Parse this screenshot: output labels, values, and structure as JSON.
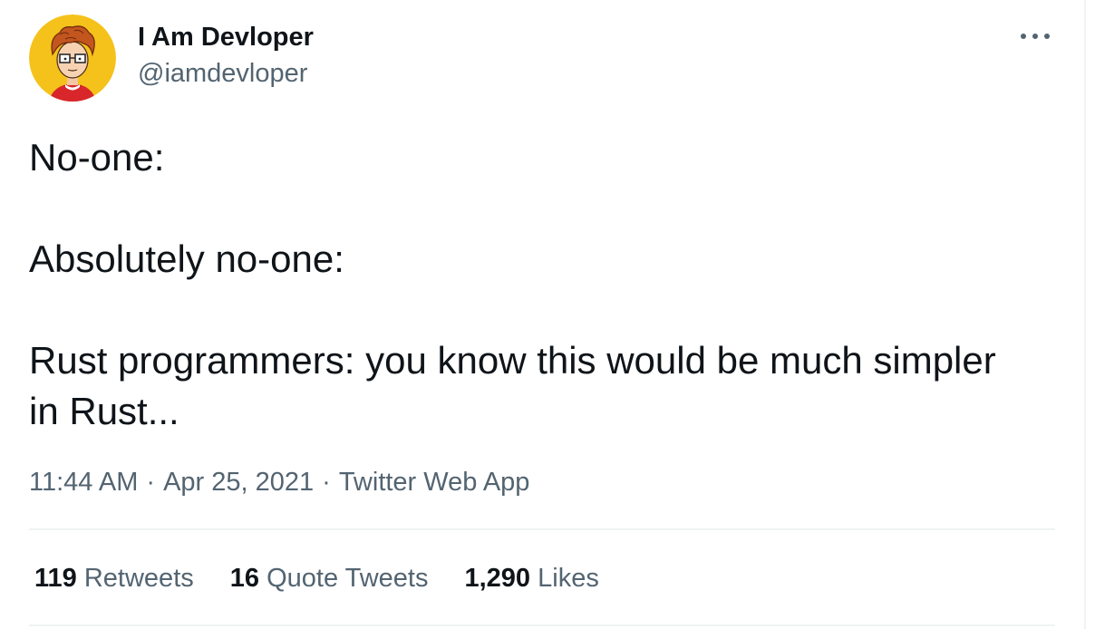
{
  "author": {
    "name": "I Am Devloper",
    "handle": "@iamdevloper"
  },
  "icons": {
    "more": "more-horizontal-icon",
    "avatar": "avatar-cartoon-developer"
  },
  "tweet": {
    "lines": [
      "No-one:",
      "Absolutely no-one:",
      "Rust programmers: you know this would be much simpler",
      "in Rust..."
    ]
  },
  "meta": {
    "time": "11:44 AM",
    "date": "Apr 25, 2021",
    "source": "Twitter Web App",
    "separator": "·"
  },
  "stats": {
    "retweets": {
      "count": "119",
      "label": "Retweets"
    },
    "quotes": {
      "count": "16",
      "label": "Quote Tweets"
    },
    "likes": {
      "count": "1,290",
      "label": "Likes"
    }
  },
  "colors": {
    "text_primary": "#0f1419",
    "text_secondary": "#536471",
    "divider": "#eff3f4",
    "avatar_bg": "#f5c21b"
  }
}
